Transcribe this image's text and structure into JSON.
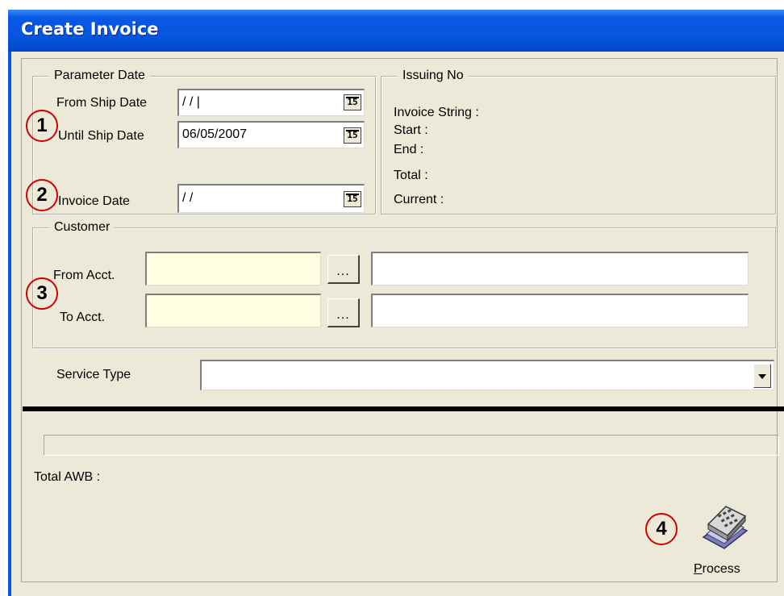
{
  "window": {
    "title": "Create Invoice"
  },
  "parameter_date": {
    "legend": "Parameter Date",
    "from_ship_date": {
      "label": "From Ship Date",
      "value": " / /   |"
    },
    "until_ship_date": {
      "label": "Until Ship Date",
      "value": "06/05/2007"
    },
    "invoice_date": {
      "label": "Invoice Date",
      "value": " / /"
    },
    "calendar_icon_text": "15"
  },
  "issuing_no": {
    "legend": "Issuing No",
    "invoice_string": "Invoice String :",
    "start": "Start :",
    "end": "End  :",
    "total": "Total :",
    "current": "Current :"
  },
  "customer": {
    "legend": "Customer",
    "from_acct": {
      "label": "From Acct.",
      "value": "",
      "name_value": ""
    },
    "to_acct": {
      "label": "To Acct.",
      "value": "",
      "name_value": ""
    },
    "browse_label": "..."
  },
  "service_type": {
    "label": "Service Type",
    "selected": ""
  },
  "progress": {
    "percent": 0
  },
  "total_awb": {
    "label": "Total AWB :"
  },
  "process": {
    "label_first": "P",
    "label_rest": "rocess"
  },
  "callouts": [
    "1",
    "2",
    "3",
    "4"
  ],
  "colors": {
    "title_bar": "#0a58e4",
    "window_bg": "#ece9d8",
    "lookup_field": "#ffffe1",
    "callout": "#d00000"
  }
}
